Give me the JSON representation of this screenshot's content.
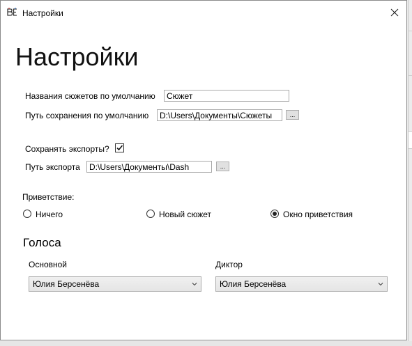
{
  "window": {
    "title": "Настройки"
  },
  "page_title": "Настройки",
  "fields": {
    "default_story_name_label": "Названия сюжетов по умолчанию",
    "default_story_name_value": "Сюжет",
    "default_save_path_label": "Путь сохранения по умолчанию",
    "default_save_path_value": "D:\\Users\\Документы\\Сюжеты",
    "browse_label": "...",
    "save_exports_label": "Сохранять экспорты?",
    "save_exports_checked": true,
    "export_path_label": "Путь экспорта",
    "export_path_value": "D:\\Users\\Документы\\Dash"
  },
  "greeting": {
    "label": "Приветствие:",
    "options": [
      {
        "label": "Ничего",
        "selected": false
      },
      {
        "label": "Новый сюжет",
        "selected": false
      },
      {
        "label": "Окно приветствия",
        "selected": true
      }
    ]
  },
  "voices": {
    "title": "Голоса",
    "main_label": "Основной",
    "main_value": "Юлия Берсенёва",
    "narrator_label": "Диктор",
    "narrator_value": "Юлия Берсенёва"
  },
  "icons": {
    "app": "app-logo-icon",
    "close": "close-icon",
    "checkmark": "checkmark-icon",
    "dropdown": "chevron-down-icon"
  },
  "colors": {
    "window_bg": "#ffffff",
    "outer_bg": "#ececec",
    "border": "#a9a9a9",
    "button_face": "#e1e1e1"
  }
}
